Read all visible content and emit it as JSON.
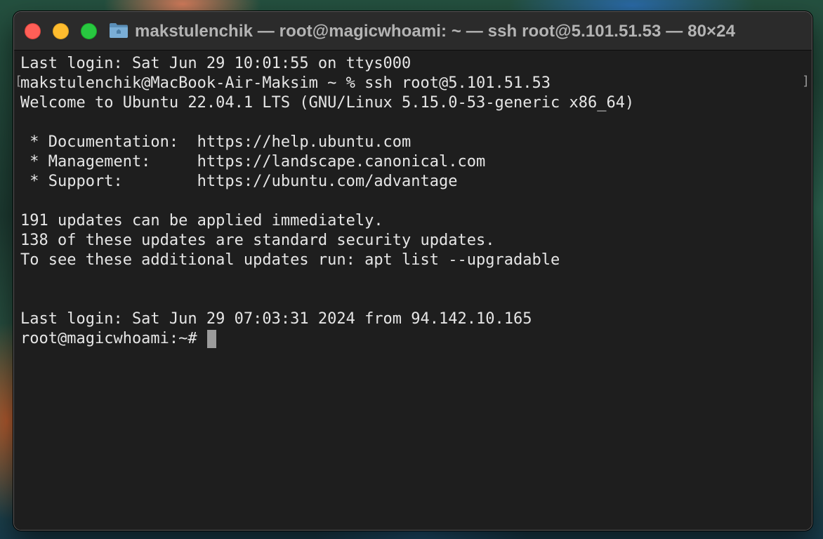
{
  "window": {
    "title": "makstulenchik — root@magicwhoami: ~ — ssh root@5.101.51.53 — 80×24",
    "icon": "folder-icon"
  },
  "colors": {
    "close": "#ff5f57",
    "minimize": "#febc2e",
    "maximize": "#28c840",
    "terminal_bg": "#1e1e1e",
    "terminal_fg": "#e6e6e6"
  },
  "terminal": {
    "lines": [
      "Last login: Sat Jun 29 10:01:55 on ttys000",
      "makstulenchik@MacBook-Air-Maksim ~ % ssh root@5.101.51.53",
      "Welcome to Ubuntu 22.04.1 LTS (GNU/Linux 5.15.0-53-generic x86_64)",
      "",
      " * Documentation:  https://help.ubuntu.com",
      " * Management:     https://landscape.canonical.com",
      " * Support:        https://ubuntu.com/advantage",
      "",
      "191 updates can be applied immediately.",
      "138 of these updates are standard security updates.",
      "To see these additional updates run: apt list --upgradable",
      "",
      "",
      "Last login: Sat Jun 29 07:03:31 2024 from 94.142.10.165"
    ],
    "prompt": "root@magicwhoami:~#",
    "mark_left": "[",
    "mark_right": "]"
  }
}
